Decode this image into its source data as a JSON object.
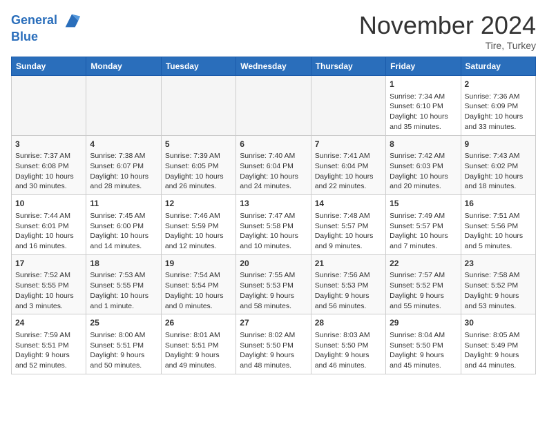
{
  "header": {
    "logo_line1": "General",
    "logo_line2": "Blue",
    "month": "November 2024",
    "location": "Tire, Turkey"
  },
  "days_of_week": [
    "Sunday",
    "Monday",
    "Tuesday",
    "Wednesday",
    "Thursday",
    "Friday",
    "Saturday"
  ],
  "weeks": [
    [
      {
        "day": "",
        "content": ""
      },
      {
        "day": "",
        "content": ""
      },
      {
        "day": "",
        "content": ""
      },
      {
        "day": "",
        "content": ""
      },
      {
        "day": "",
        "content": ""
      },
      {
        "day": "1",
        "content": "Sunrise: 7:34 AM\nSunset: 6:10 PM\nDaylight: 10 hours and 35 minutes."
      },
      {
        "day": "2",
        "content": "Sunrise: 7:36 AM\nSunset: 6:09 PM\nDaylight: 10 hours and 33 minutes."
      }
    ],
    [
      {
        "day": "3",
        "content": "Sunrise: 7:37 AM\nSunset: 6:08 PM\nDaylight: 10 hours and 30 minutes."
      },
      {
        "day": "4",
        "content": "Sunrise: 7:38 AM\nSunset: 6:07 PM\nDaylight: 10 hours and 28 minutes."
      },
      {
        "day": "5",
        "content": "Sunrise: 7:39 AM\nSunset: 6:05 PM\nDaylight: 10 hours and 26 minutes."
      },
      {
        "day": "6",
        "content": "Sunrise: 7:40 AM\nSunset: 6:04 PM\nDaylight: 10 hours and 24 minutes."
      },
      {
        "day": "7",
        "content": "Sunrise: 7:41 AM\nSunset: 6:04 PM\nDaylight: 10 hours and 22 minutes."
      },
      {
        "day": "8",
        "content": "Sunrise: 7:42 AM\nSunset: 6:03 PM\nDaylight: 10 hours and 20 minutes."
      },
      {
        "day": "9",
        "content": "Sunrise: 7:43 AM\nSunset: 6:02 PM\nDaylight: 10 hours and 18 minutes."
      }
    ],
    [
      {
        "day": "10",
        "content": "Sunrise: 7:44 AM\nSunset: 6:01 PM\nDaylight: 10 hours and 16 minutes."
      },
      {
        "day": "11",
        "content": "Sunrise: 7:45 AM\nSunset: 6:00 PM\nDaylight: 10 hours and 14 minutes."
      },
      {
        "day": "12",
        "content": "Sunrise: 7:46 AM\nSunset: 5:59 PM\nDaylight: 10 hours and 12 minutes."
      },
      {
        "day": "13",
        "content": "Sunrise: 7:47 AM\nSunset: 5:58 PM\nDaylight: 10 hours and 10 minutes."
      },
      {
        "day": "14",
        "content": "Sunrise: 7:48 AM\nSunset: 5:57 PM\nDaylight: 10 hours and 9 minutes."
      },
      {
        "day": "15",
        "content": "Sunrise: 7:49 AM\nSunset: 5:57 PM\nDaylight: 10 hours and 7 minutes."
      },
      {
        "day": "16",
        "content": "Sunrise: 7:51 AM\nSunset: 5:56 PM\nDaylight: 10 hours and 5 minutes."
      }
    ],
    [
      {
        "day": "17",
        "content": "Sunrise: 7:52 AM\nSunset: 5:55 PM\nDaylight: 10 hours and 3 minutes."
      },
      {
        "day": "18",
        "content": "Sunrise: 7:53 AM\nSunset: 5:55 PM\nDaylight: 10 hours and 1 minute."
      },
      {
        "day": "19",
        "content": "Sunrise: 7:54 AM\nSunset: 5:54 PM\nDaylight: 10 hours and 0 minutes."
      },
      {
        "day": "20",
        "content": "Sunrise: 7:55 AM\nSunset: 5:53 PM\nDaylight: 9 hours and 58 minutes."
      },
      {
        "day": "21",
        "content": "Sunrise: 7:56 AM\nSunset: 5:53 PM\nDaylight: 9 hours and 56 minutes."
      },
      {
        "day": "22",
        "content": "Sunrise: 7:57 AM\nSunset: 5:52 PM\nDaylight: 9 hours and 55 minutes."
      },
      {
        "day": "23",
        "content": "Sunrise: 7:58 AM\nSunset: 5:52 PM\nDaylight: 9 hours and 53 minutes."
      }
    ],
    [
      {
        "day": "24",
        "content": "Sunrise: 7:59 AM\nSunset: 5:51 PM\nDaylight: 9 hours and 52 minutes."
      },
      {
        "day": "25",
        "content": "Sunrise: 8:00 AM\nSunset: 5:51 PM\nDaylight: 9 hours and 50 minutes."
      },
      {
        "day": "26",
        "content": "Sunrise: 8:01 AM\nSunset: 5:51 PM\nDaylight: 9 hours and 49 minutes."
      },
      {
        "day": "27",
        "content": "Sunrise: 8:02 AM\nSunset: 5:50 PM\nDaylight: 9 hours and 48 minutes."
      },
      {
        "day": "28",
        "content": "Sunrise: 8:03 AM\nSunset: 5:50 PM\nDaylight: 9 hours and 46 minutes."
      },
      {
        "day": "29",
        "content": "Sunrise: 8:04 AM\nSunset: 5:50 PM\nDaylight: 9 hours and 45 minutes."
      },
      {
        "day": "30",
        "content": "Sunrise: 8:05 AM\nSunset: 5:49 PM\nDaylight: 9 hours and 44 minutes."
      }
    ]
  ]
}
